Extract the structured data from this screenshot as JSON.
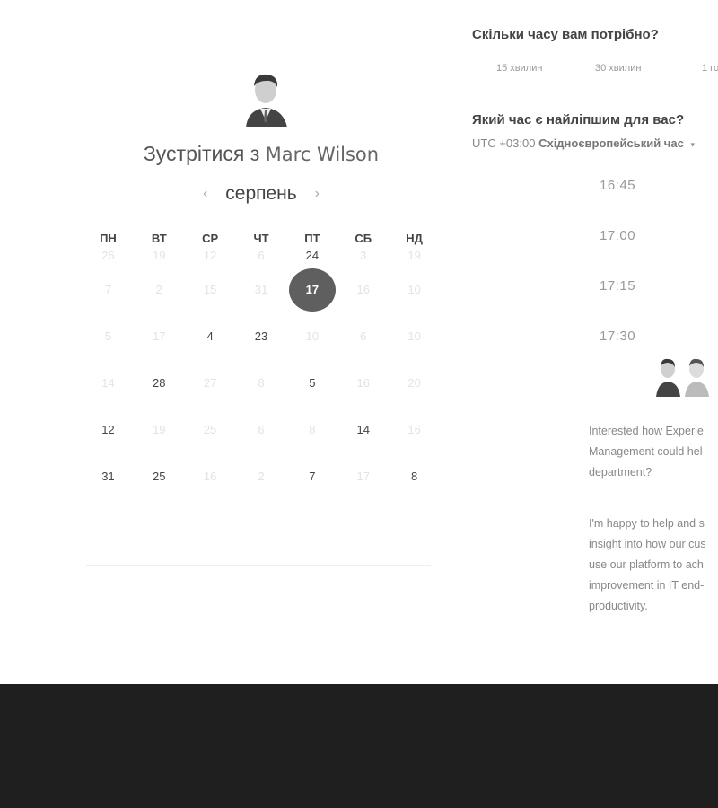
{
  "booking": {
    "title_prefix": "Зустрітися з",
    "host_name": "Marc Wilson",
    "month": "серпень",
    "prev_arrow": "‹",
    "next_arrow": "›"
  },
  "calendar": {
    "weekdays": [
      "ПН",
      "ВТ",
      "СР",
      "ЧТ",
      "ПТ",
      "СБ",
      "НД"
    ],
    "rows": [
      [
        {
          "d": "26",
          "s": "faded"
        },
        {
          "d": "19",
          "s": "faded"
        },
        {
          "d": "12",
          "s": "faded"
        },
        {
          "d": "6",
          "s": "faded"
        },
        {
          "d": "24",
          "s": "active"
        },
        {
          "d": "3",
          "s": "faded"
        },
        {
          "d": "19",
          "s": "faded"
        }
      ],
      [
        {
          "d": "7",
          "s": "faded"
        },
        {
          "d": "2",
          "s": "faded"
        },
        {
          "d": "15",
          "s": "faded"
        },
        {
          "d": "31",
          "s": "faded"
        },
        {
          "d": "17",
          "s": "selected"
        },
        {
          "d": "16",
          "s": "faded"
        },
        {
          "d": "10",
          "s": "faded"
        }
      ],
      [
        {
          "d": "5",
          "s": "faded"
        },
        {
          "d": "17",
          "s": "faded"
        },
        {
          "d": "4",
          "s": "active"
        },
        {
          "d": "23",
          "s": "active"
        },
        {
          "d": "10",
          "s": "faded"
        },
        {
          "d": "6",
          "s": "faded"
        },
        {
          "d": "10",
          "s": "faded"
        }
      ],
      [
        {
          "d": "14",
          "s": "faded"
        },
        {
          "d": "28",
          "s": "active"
        },
        {
          "d": "27",
          "s": "faded"
        },
        {
          "d": "8",
          "s": "faded"
        },
        {
          "d": "5",
          "s": "active"
        },
        {
          "d": "16",
          "s": "faded"
        },
        {
          "d": "20",
          "s": "faded"
        }
      ],
      [
        {
          "d": "12",
          "s": "active"
        },
        {
          "d": "19",
          "s": "faded"
        },
        {
          "d": "25",
          "s": "faded"
        },
        {
          "d": "6",
          "s": "faded"
        },
        {
          "d": "8",
          "s": "faded"
        },
        {
          "d": "14",
          "s": "active"
        },
        {
          "d": "16",
          "s": "faded"
        }
      ],
      [
        {
          "d": "31",
          "s": "active"
        },
        {
          "d": "25",
          "s": "active"
        },
        {
          "d": "16",
          "s": "faded"
        },
        {
          "d": "2",
          "s": "faded"
        },
        {
          "d": "7",
          "s": "active"
        },
        {
          "d": "17",
          "s": "faded"
        },
        {
          "d": "8",
          "s": "active"
        }
      ]
    ]
  },
  "duration": {
    "question": "Скільки часу вам потрібно?",
    "options": [
      "15 хвилин",
      "30 хвилин",
      "1 го"
    ]
  },
  "time": {
    "question": "Який час є найліпшим для вас?",
    "tz_offset": "UTC +03:00",
    "tz_name": "Східноєвропейський час",
    "tz_caret": "▾",
    "slots": [
      "16:45",
      "17:00",
      "17:15",
      "17:30"
    ]
  },
  "description": {
    "p1_lines": [
      "Interested how Experie",
      "Management could hel",
      "department?"
    ],
    "p2_lines": [
      "I'm happy to help and s",
      "insight into how our cus",
      "use our platform to ach",
      "improvement in IT end-",
      "productivity."
    ]
  }
}
